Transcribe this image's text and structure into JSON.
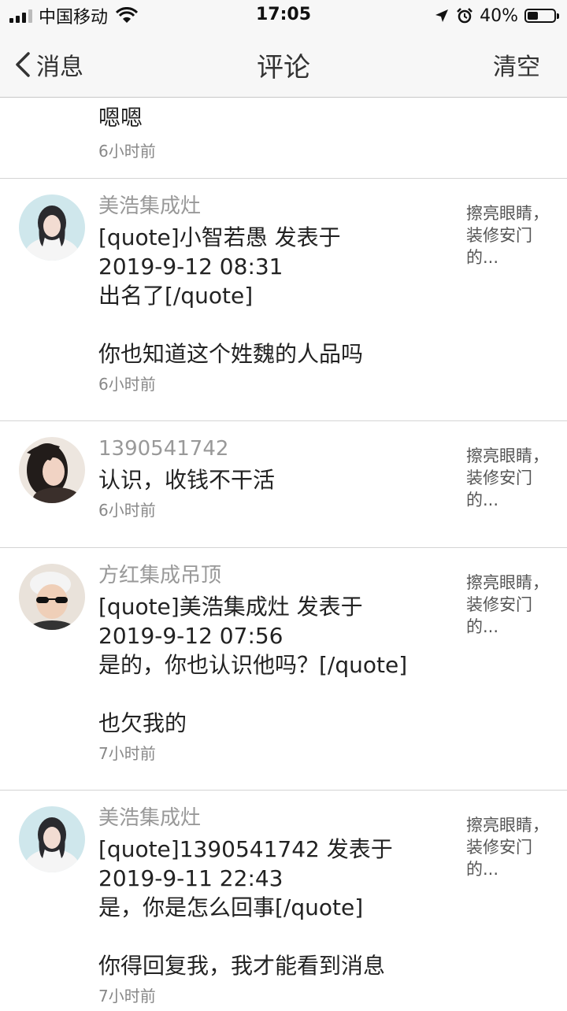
{
  "status_bar": {
    "carrier": "中国移动",
    "time": "17:05",
    "battery_percent": "40%",
    "battery_level": 0.4,
    "icons": [
      "signal-icon",
      "wifi-icon",
      "location-arrow-icon",
      "alarm-icon",
      "battery-icon"
    ]
  },
  "nav": {
    "back_label": "消息",
    "title": "评论",
    "clear_label": "清空"
  },
  "comments": [
    {
      "text": "嗯嗯",
      "time": "6小时前"
    },
    {
      "author": "美浩集成灶",
      "text": "[quote]小智若愚 发表于\n2019-9-12 08:31\n出名了[/quote]\n\n你也知道这个姓魏的人品吗",
      "time": "6小时前",
      "ref": "擦亮眼睛，装修安门的..."
    },
    {
      "author": "1390541742",
      "text": "认识，收钱不干活",
      "time": "6小时前",
      "ref": "擦亮眼睛，装修安门的..."
    },
    {
      "author": "方红集成吊顶",
      "text": "[quote]美浩集成灶 发表于\n2019-9-12 07:56\n是的，你也认识他吗？[/quote]\n\n也欠我的",
      "time": "7小时前",
      "ref": "擦亮眼睛，装修安门的..."
    },
    {
      "author": "美浩集成灶",
      "text": "[quote]1390541742 发表于\n2019-9-11 22:43\n是，你是怎么回事[/quote]\n\n你得回复我，我才能看到消息",
      "time": "7小时前",
      "ref": "擦亮眼睛，装修安门的..."
    }
  ]
}
